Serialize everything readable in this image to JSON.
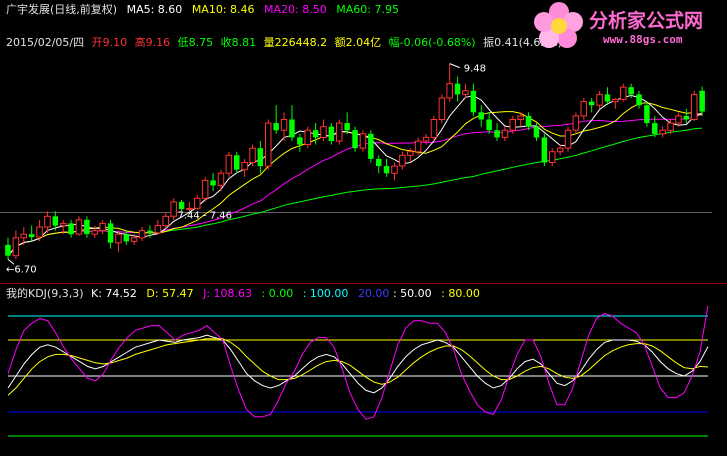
{
  "header_line1": {
    "title": "广宇发展(日线,前复权)",
    "ma5": "MA5: 8.60",
    "ma10": "MA10: 8.46",
    "ma20": "MA20: 8.50",
    "ma60": "MA60: 7.95"
  },
  "header_line2": {
    "date": "2015/02/05/四",
    "open": "开9.10",
    "high": "高9.16",
    "low": "低8.75",
    "close": "收8.81",
    "volume": "量226448.2",
    "amount": "额2.04亿",
    "change": "幅-0.06(-0.68%)",
    "amplitude": "振0.41(4.62%)"
  },
  "kdj_header": {
    "name": "我的KDJ(9,3,3)",
    "k": "K: 74.52",
    "d": "D: 57.47",
    "j": "J: 108.63",
    "l0": ": 0.00",
    "l100": ": 100.00",
    "l20": "20.00",
    "l50": ": 50.00",
    "l80": ": 80.00"
  },
  "logo": {
    "text": "分析家公式网",
    "url": "www.88gs.com"
  },
  "annotations": {
    "high": "9.48",
    "low": "6.70",
    "mid": "7.44 - 7.46"
  },
  "colors": {
    "up": "#ff3232",
    "down": "#00ff00",
    "ma5": "#ffffff",
    "ma10": "#ffff00",
    "ma20": "#ff00ff",
    "ma60": "#00ff00",
    "k": "#ffffff",
    "d": "#ffff00",
    "j": "#ff00ff",
    "line0": "#00ff00",
    "line20": "#0000ff",
    "line50": "#ffffff",
    "line80": "#ffff00",
    "line100": "#00ffff"
  },
  "chart_data": [
    {
      "type": "candlestick",
      "ylim": [
        6.6,
        9.6
      ],
      "candles": [
        [
          6.95,
          7.05,
          6.75,
          6.8
        ],
        [
          6.8,
          7.15,
          6.75,
          7.05
        ],
        [
          7.05,
          7.2,
          6.95,
          7.1
        ],
        [
          7.1,
          7.22,
          7.0,
          7.06
        ],
        [
          7.06,
          7.3,
          7.0,
          7.2
        ],
        [
          7.2,
          7.42,
          7.12,
          7.35
        ],
        [
          7.35,
          7.42,
          7.15,
          7.22
        ],
        [
          7.22,
          7.3,
          7.1,
          7.25
        ],
        [
          7.25,
          7.3,
          7.05,
          7.1
        ],
        [
          7.1,
          7.35,
          7.08,
          7.3
        ],
        [
          7.3,
          7.35,
          7.05,
          7.1
        ],
        [
          7.1,
          7.22,
          7.05,
          7.15
        ],
        [
          7.15,
          7.3,
          7.1,
          7.25
        ],
        [
          7.25,
          7.3,
          6.9,
          6.98
        ],
        [
          6.98,
          7.15,
          6.85,
          7.1
        ],
        [
          7.1,
          7.15,
          6.95,
          7.0
        ],
        [
          7.0,
          7.1,
          6.95,
          7.05
        ],
        [
          7.05,
          7.2,
          7.0,
          7.15
        ],
        [
          7.15,
          7.22,
          7.05,
          7.12
        ],
        [
          7.12,
          7.3,
          7.1,
          7.22
        ],
        [
          7.22,
          7.4,
          7.18,
          7.35
        ],
        [
          7.35,
          7.6,
          7.3,
          7.55
        ],
        [
          7.55,
          7.58,
          7.42,
          7.45
        ],
        [
          7.45,
          7.55,
          7.42,
          7.46
        ],
        [
          7.46,
          7.65,
          7.44,
          7.6
        ],
        [
          7.6,
          7.9,
          7.55,
          7.85
        ],
        [
          7.85,
          7.95,
          7.7,
          7.78
        ],
        [
          7.78,
          8.0,
          7.7,
          7.95
        ],
        [
          7.95,
          8.25,
          7.9,
          8.2
        ],
        [
          8.2,
          8.25,
          7.95,
          8.0
        ],
        [
          8.0,
          8.15,
          7.9,
          8.1
        ],
        [
          8.1,
          8.35,
          8.05,
          8.3
        ],
        [
          8.3,
          8.4,
          7.95,
          8.05
        ],
        [
          8.05,
          8.7,
          8.0,
          8.65
        ],
        [
          8.65,
          8.9,
          8.5,
          8.55
        ],
        [
          8.55,
          8.8,
          8.4,
          8.7
        ],
        [
          8.7,
          8.9,
          8.4,
          8.45
        ],
        [
          8.45,
          8.5,
          8.25,
          8.35
        ],
        [
          8.35,
          8.6,
          8.3,
          8.55
        ],
        [
          8.55,
          8.65,
          8.35,
          8.45
        ],
        [
          8.45,
          8.7,
          8.4,
          8.6
        ],
        [
          8.6,
          8.65,
          8.35,
          8.4
        ],
        [
          8.4,
          8.7,
          8.35,
          8.65
        ],
        [
          8.65,
          8.8,
          8.5,
          8.55
        ],
        [
          8.55,
          8.6,
          8.25,
          8.3
        ],
        [
          8.3,
          8.55,
          8.25,
          8.5
        ],
        [
          8.5,
          8.55,
          8.1,
          8.15
        ],
        [
          8.15,
          8.2,
          7.95,
          8.05
        ],
        [
          8.05,
          8.15,
          7.9,
          7.95
        ],
        [
          7.95,
          8.1,
          7.85,
          8.05
        ],
        [
          8.05,
          8.25,
          8.0,
          8.2
        ],
        [
          8.2,
          8.3,
          8.1,
          8.25
        ],
        [
          8.25,
          8.45,
          8.2,
          8.4
        ],
        [
          8.4,
          8.5,
          8.35,
          8.45
        ],
        [
          8.45,
          8.75,
          8.4,
          8.7
        ],
        [
          8.7,
          9.05,
          8.65,
          9.0
        ],
        [
          9.0,
          9.48,
          8.95,
          9.2
        ],
        [
          9.2,
          9.3,
          8.95,
          9.05
        ],
        [
          9.05,
          9.2,
          9.0,
          9.1
        ],
        [
          9.1,
          9.2,
          8.75,
          8.8
        ],
        [
          8.8,
          8.9,
          8.6,
          8.7
        ],
        [
          8.7,
          8.8,
          8.5,
          8.55
        ],
        [
          8.55,
          8.65,
          8.4,
          8.45
        ],
        [
          8.45,
          8.6,
          8.4,
          8.55
        ],
        [
          8.55,
          8.75,
          8.5,
          8.7
        ],
        [
          8.7,
          8.8,
          8.6,
          8.75
        ],
        [
          8.75,
          8.8,
          8.55,
          8.6
        ],
        [
          8.6,
          8.65,
          8.4,
          8.45
        ],
        [
          8.45,
          8.5,
          8.05,
          8.1
        ],
        [
          8.1,
          8.3,
          8.05,
          8.25
        ],
        [
          8.25,
          8.35,
          8.2,
          8.3
        ],
        [
          8.3,
          8.6,
          8.25,
          8.55
        ],
        [
          8.55,
          8.8,
          8.5,
          8.75
        ],
        [
          8.75,
          9.0,
          8.7,
          8.95
        ],
        [
          8.95,
          9.0,
          8.8,
          8.9
        ],
        [
          8.9,
          9.1,
          8.85,
          9.05
        ],
        [
          9.05,
          9.15,
          8.9,
          8.95
        ],
        [
          8.95,
          9.0,
          8.85,
          8.98
        ],
        [
          8.98,
          9.2,
          8.95,
          9.15
        ],
        [
          9.15,
          9.2,
          9.0,
          9.05
        ],
        [
          9.05,
          9.1,
          8.85,
          8.9
        ],
        [
          8.9,
          8.95,
          8.6,
          8.65
        ],
        [
          8.65,
          8.75,
          8.45,
          8.5
        ],
        [
          8.5,
          8.6,
          8.45,
          8.55
        ],
        [
          8.55,
          8.7,
          8.5,
          8.65
        ],
        [
          8.65,
          8.8,
          8.6,
          8.75
        ],
        [
          8.75,
          8.85,
          8.65,
          8.7
        ],
        [
          8.7,
          9.1,
          8.68,
          9.05
        ],
        [
          9.1,
          9.16,
          8.75,
          8.81
        ]
      ],
      "ma_period_labels": [
        "MA5",
        "MA10",
        "MA20",
        "MA60"
      ]
    },
    {
      "type": "line",
      "title": "我的KDJ(9,3,3)",
      "ylim": [
        -10,
        115
      ],
      "reference_lines": [
        0,
        20,
        50,
        80,
        100
      ],
      "series": [
        {
          "name": "K",
          "values": [
            40,
            50,
            60,
            68,
            74,
            76,
            74,
            70,
            66,
            62,
            58,
            56,
            58,
            62,
            66,
            70,
            74,
            76,
            78,
            80,
            79,
            78,
            80,
            81,
            82,
            84,
            82,
            80,
            72,
            62,
            52,
            46,
            42,
            40,
            42,
            46,
            50,
            56,
            62,
            66,
            68,
            66,
            60,
            52,
            44,
            38,
            36,
            40,
            48,
            58,
            66,
            72,
            76,
            78,
            80,
            78,
            74,
            66,
            58,
            50,
            44,
            40,
            42,
            48,
            56,
            62,
            64,
            60,
            52,
            44,
            42,
            46,
            54,
            64,
            72,
            78,
            80,
            80,
            80,
            79,
            76,
            70,
            62,
            56,
            52,
            50,
            54,
            62,
            74.52
          ]
        },
        {
          "name": "D",
          "values": [
            34,
            40,
            48,
            56,
            62,
            66,
            68,
            68,
            67,
            65,
            63,
            61,
            60,
            61,
            63,
            65,
            68,
            70,
            72,
            74,
            76,
            77,
            78,
            79,
            80,
            81,
            81,
            81,
            78,
            73,
            66,
            60,
            54,
            50,
            47,
            47,
            48,
            51,
            55,
            59,
            62,
            63,
            62,
            59,
            54,
            49,
            45,
            43,
            45,
            49,
            55,
            61,
            66,
            70,
            73,
            75,
            75,
            72,
            67,
            61,
            55,
            50,
            47,
            47,
            50,
            54,
            57,
            58,
            56,
            52,
            49,
            48,
            50,
            55,
            61,
            67,
            71,
            74,
            76,
            77,
            77,
            75,
            71,
            66,
            61,
            57,
            56,
            58,
            57.47
          ]
        },
        {
          "name": "J",
          "values": [
            52,
            72,
            88,
            94,
            98,
            96,
            86,
            74,
            64,
            56,
            48,
            46,
            52,
            64,
            74,
            82,
            88,
            90,
            92,
            92,
            86,
            80,
            84,
            86,
            88,
            92,
            86,
            80,
            58,
            38,
            22,
            16,
            16,
            18,
            30,
            44,
            54,
            68,
            78,
            82,
            82,
            74,
            56,
            36,
            22,
            14,
            16,
            32,
            54,
            76,
            90,
            96,
            96,
            94,
            94,
            86,
            72,
            52,
            38,
            26,
            20,
            18,
            30,
            50,
            68,
            80,
            80,
            66,
            44,
            26,
            26,
            40,
            62,
            84,
            98,
            102,
            100,
            94,
            90,
            86,
            76,
            58,
            40,
            32,
            32,
            36,
            50,
            70,
            108.63
          ]
        }
      ]
    }
  ]
}
